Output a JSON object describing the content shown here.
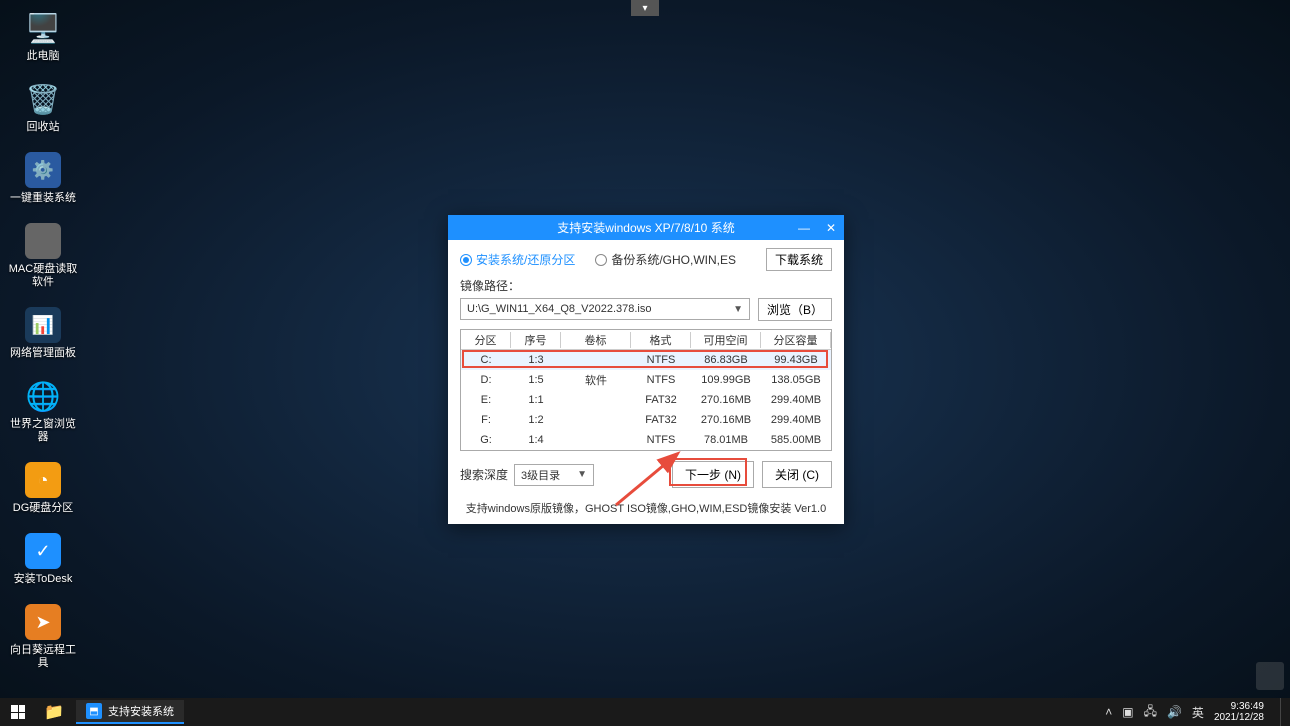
{
  "desktop_icons": [
    {
      "label": "此电脑",
      "glyph": "🖥️",
      "bg": ""
    },
    {
      "label": "回收站",
      "glyph": "🗑️",
      "bg": ""
    },
    {
      "label": "一键重装系统",
      "glyph": "⚙️",
      "bg": "#2a5aa0"
    },
    {
      "label": "MAC硬盘读取软件",
      "glyph": "",
      "bg": "#666"
    },
    {
      "label": "网络管理面板",
      "glyph": "📊",
      "bg": "#1a3a5a"
    },
    {
      "label": "世界之窗浏览器",
      "glyph": "🌐",
      "bg": ""
    },
    {
      "label": "DG硬盘分区",
      "glyph": "◔",
      "bg": "#f39c12"
    },
    {
      "label": "安装ToDesk",
      "glyph": "✓",
      "bg": "#1e90ff"
    },
    {
      "label": "向日葵远程工具",
      "glyph": "➤",
      "bg": "#e67e22"
    }
  ],
  "dialog": {
    "title": "支持安装windows XP/7/8/10 系统",
    "radio_install": "安装系统/还原分区",
    "radio_backup": "备份系统/GHO,WIN,ES",
    "download_btn": "下载系统",
    "path_label": "镜像路径：",
    "path_value": "U:\\G_WIN11_X64_Q8_V2022.378.iso",
    "browse_btn": "浏览（B）",
    "columns": {
      "part": "分区",
      "seq": "序号",
      "vol": "卷标",
      "fmt": "格式",
      "free": "可用空间",
      "cap": "分区容量"
    },
    "rows": [
      {
        "part": "C:",
        "seq": "1:3",
        "vol": "",
        "fmt": "NTFS",
        "free": "86.83GB",
        "cap": "99.43GB"
      },
      {
        "part": "D:",
        "seq": "1:5",
        "vol": "软件",
        "fmt": "NTFS",
        "free": "109.99GB",
        "cap": "138.05GB"
      },
      {
        "part": "E:",
        "seq": "1:1",
        "vol": "",
        "fmt": "FAT32",
        "free": "270.16MB",
        "cap": "299.40MB"
      },
      {
        "part": "F:",
        "seq": "1:2",
        "vol": "",
        "fmt": "FAT32",
        "free": "270.16MB",
        "cap": "299.40MB"
      },
      {
        "part": "G:",
        "seq": "1:4",
        "vol": "",
        "fmt": "NTFS",
        "free": "78.01MB",
        "cap": "585.00MB"
      }
    ],
    "depth_label": "搜索深度",
    "depth_value": "3级目录",
    "next_btn": "下一步 (N)",
    "close_btn": "关闭 (C)",
    "footer": "支持windows原版镜像，GHOST ISO镜像,GHO,WIM,ESD镜像安装 Ver1.0"
  },
  "taskbar": {
    "app_title": "支持安装系统",
    "time": "9:36:49",
    "date": "2021/12/28"
  }
}
